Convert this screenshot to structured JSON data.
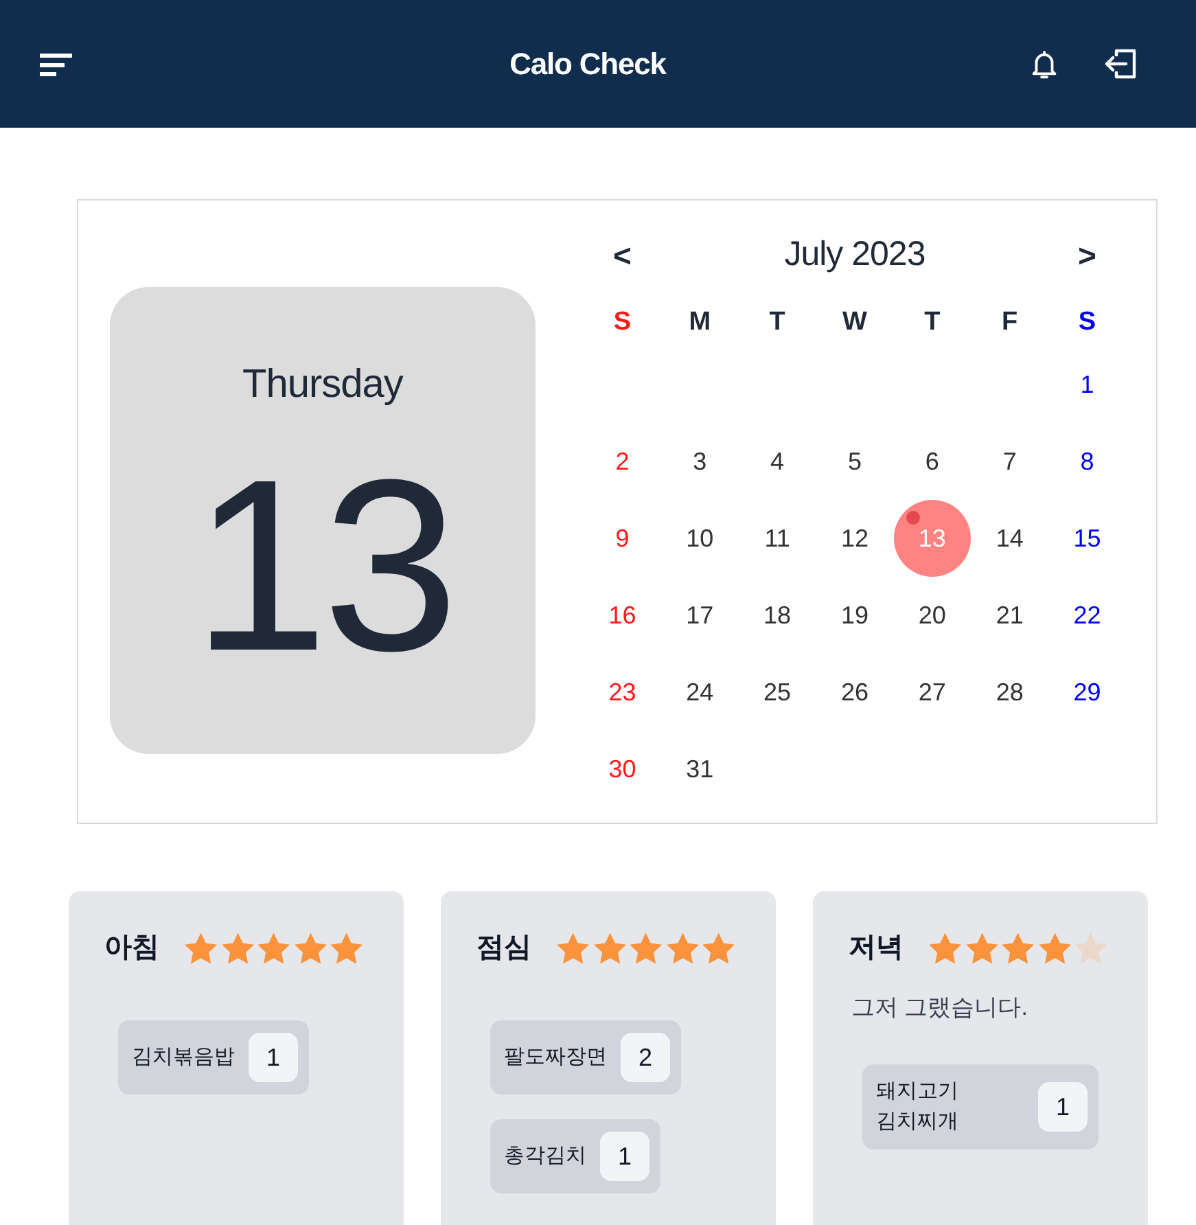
{
  "header": {
    "title": "Calo Check"
  },
  "date_tile": {
    "weekday": "Thursday",
    "day": "13"
  },
  "calendar": {
    "prev": "<",
    "title": "July 2023",
    "next": ">",
    "weekdays": [
      "S",
      "M",
      "T",
      "W",
      "T",
      "F",
      "S"
    ],
    "weeks": [
      {
        "days": [
          {
            "day": "1",
            "selected": false,
            "marked": false
          }
        ]
      },
      {
        "days": [
          {
            "day": "2",
            "selected": false,
            "marked": false
          },
          {
            "day": "3",
            "selected": false,
            "marked": false
          },
          {
            "day": "4",
            "selected": false,
            "marked": false
          },
          {
            "day": "5",
            "selected": false,
            "marked": false
          },
          {
            "day": "6",
            "selected": false,
            "marked": false
          },
          {
            "day": "7",
            "selected": false,
            "marked": false
          },
          {
            "day": "8",
            "selected": false,
            "marked": false
          }
        ]
      },
      {
        "days": [
          {
            "day": "9",
            "selected": false,
            "marked": false
          },
          {
            "day": "10",
            "selected": false,
            "marked": false
          },
          {
            "day": "11",
            "selected": false,
            "marked": false
          },
          {
            "day": "12",
            "selected": false,
            "marked": false
          },
          {
            "day": "13",
            "selected": true,
            "marked": true
          },
          {
            "day": "14",
            "selected": false,
            "marked": false
          },
          {
            "day": "15",
            "selected": false,
            "marked": false
          }
        ]
      },
      {
        "days": [
          {
            "day": "16",
            "selected": false,
            "marked": false
          },
          {
            "day": "17",
            "selected": false,
            "marked": false
          },
          {
            "day": "18",
            "selected": false,
            "marked": false
          },
          {
            "day": "19",
            "selected": false,
            "marked": false
          },
          {
            "day": "20",
            "selected": false,
            "marked": false
          },
          {
            "day": "21",
            "selected": false,
            "marked": false
          },
          {
            "day": "22",
            "selected": false,
            "marked": false
          }
        ]
      },
      {
        "days": [
          {
            "day": "23",
            "selected": false,
            "marked": false
          },
          {
            "day": "24",
            "selected": false,
            "marked": false
          },
          {
            "day": "25",
            "selected": false,
            "marked": false
          },
          {
            "day": "26",
            "selected": false,
            "marked": false
          },
          {
            "day": "27",
            "selected": false,
            "marked": false
          },
          {
            "day": "28",
            "selected": false,
            "marked": false
          },
          {
            "day": "29",
            "selected": false,
            "marked": false
          }
        ]
      },
      {
        "days": [
          {
            "day": "30",
            "selected": false,
            "marked": false
          },
          {
            "day": "31",
            "selected": false,
            "marked": false
          }
        ]
      }
    ]
  },
  "meals": [
    {
      "title": "아침",
      "stars": 5,
      "foods": [
        {
          "name": "김치볶음밥",
          "count": "1"
        }
      ]
    },
    {
      "title": "점심",
      "stars": 5,
      "foods": [
        {
          "name": "팔도짜장면",
          "count": "2"
        },
        {
          "name": "총각김치",
          "count": "1"
        }
      ]
    },
    {
      "title": "저녁",
      "stars": 4,
      "comment": "그저 그랬습니다.",
      "foods": [
        {
          "name": "돼지고기 김치찌개",
          "count": "1"
        }
      ]
    }
  ]
}
